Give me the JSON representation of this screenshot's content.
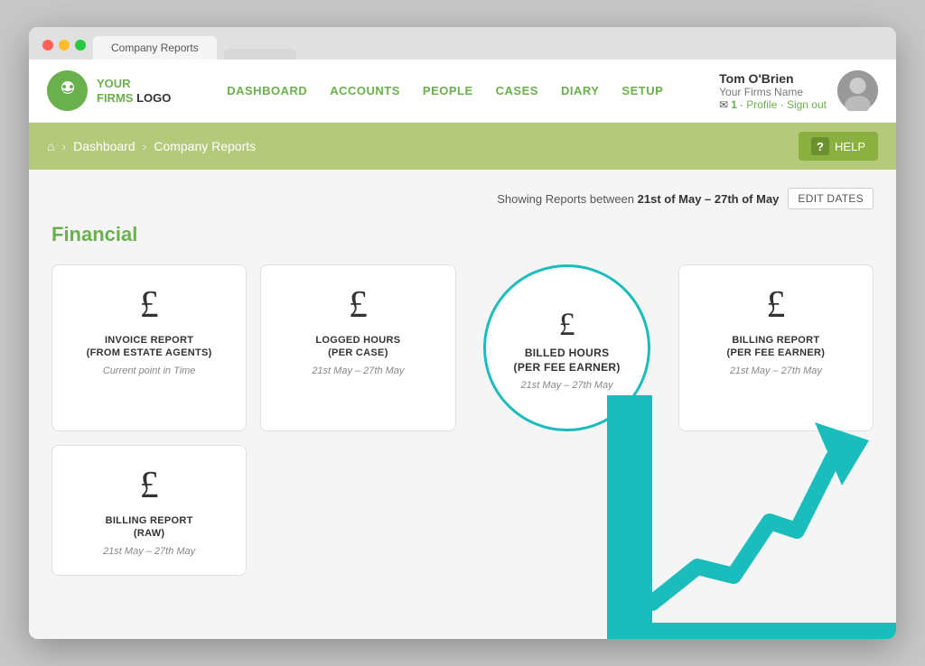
{
  "browser": {
    "tab1": "Company Reports",
    "tab2": ""
  },
  "nav": {
    "logo_line1": "YOUR",
    "logo_line2": "FIRMS",
    "logo_line3": "LOGO",
    "items": [
      {
        "label": "DASHBOARD",
        "id": "dashboard"
      },
      {
        "label": "ACCOUNTS",
        "id": "accounts"
      },
      {
        "label": "PEOPLE",
        "id": "people"
      },
      {
        "label": "CASES",
        "id": "cases"
      },
      {
        "label": "DIARY",
        "id": "diary"
      },
      {
        "label": "SETUP",
        "id": "setup"
      }
    ],
    "user": {
      "name": "Tom O'Brien",
      "firm": "Your Firms Name",
      "mail_count": "1",
      "profile_link": "Profile",
      "signout_link": "Sign out"
    }
  },
  "breadcrumb": {
    "home_label": "⌂",
    "dashboard": "Dashboard",
    "current": "Company Reports",
    "help_label": "HELP",
    "question_mark": "?"
  },
  "reports": {
    "showing_label": "Showing Reports between",
    "date_range": "21st of May – 27th of May",
    "edit_dates_btn": "EDIT DATES",
    "section_title": "Financial",
    "cards": [
      {
        "id": "invoice-report",
        "icon": "£",
        "title": "INVOICE REPORT\n(FROM ESTATE AGENTS)",
        "subtitle": "Current point in Time",
        "highlighted": false
      },
      {
        "id": "logged-hours",
        "icon": "£",
        "title": "LOGGED HOURS\n(PER CASE)",
        "subtitle": "21st May – 27th May",
        "highlighted": false
      },
      {
        "id": "billed-hours",
        "icon": "£",
        "title": "BILLED HOURS\n(PER FEE EARNER)",
        "subtitle": "21st May – 27th May",
        "highlighted": true
      },
      {
        "id": "billing-report-fee",
        "icon": "£",
        "title": "BILLING REPORT\n(PER FEE EARNER)",
        "subtitle": "21st May – 27th May",
        "highlighted": false
      }
    ],
    "cards_row2": [
      {
        "id": "billing-report-raw",
        "icon": "£",
        "title": "BILLING REPORT\n(RAW)",
        "subtitle": "21st May – 27th May",
        "highlighted": false
      }
    ]
  },
  "chart": {
    "color": "#1abcbc"
  }
}
